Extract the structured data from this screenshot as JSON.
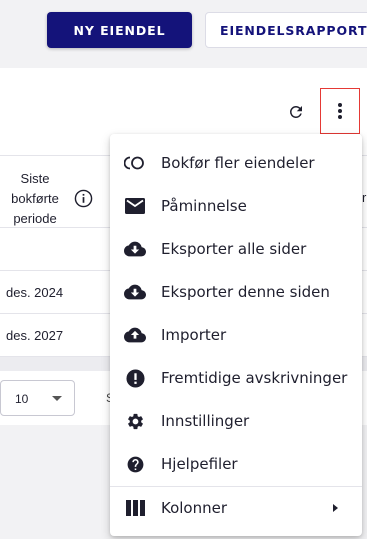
{
  "header": {
    "new_asset_label": "NY EIENDEL",
    "asset_report_label": "EIENDELSRAPPORT"
  },
  "table": {
    "column_header_lines": [
      "Siste",
      "bokførte",
      "periode"
    ],
    "rows": [
      {
        "period": "des. 2024"
      },
      {
        "period": "des. 2027"
      }
    ],
    "right_edge_glyph": "r"
  },
  "pagination": {
    "rows_per_page": "10",
    "partial_text": "S"
  },
  "menu": {
    "items": [
      {
        "label": "Bokfør fler eiendeler",
        "icon": "multiple-circles-icon"
      },
      {
        "label": "Påminnelse",
        "icon": "mail-icon"
      },
      {
        "label": "Eksporter alle sider",
        "icon": "cloud-download-icon"
      },
      {
        "label": "Eksporter denne siden",
        "icon": "cloud-download-icon"
      },
      {
        "label": "Importer",
        "icon": "cloud-upload-icon"
      },
      {
        "label": "Fremtidige avskrivninger",
        "icon": "alert-circle-icon"
      },
      {
        "label": "Innstillinger",
        "icon": "gear-icon"
      },
      {
        "label": "Hjelpefiler",
        "icon": "help-circle-icon"
      },
      {
        "label": "Kolonner",
        "icon": "columns-icon",
        "has_submenu": true
      }
    ]
  },
  "colors": {
    "primary": "#14137a",
    "highlight_border": "#e53935",
    "text": "#1f1f2e"
  }
}
